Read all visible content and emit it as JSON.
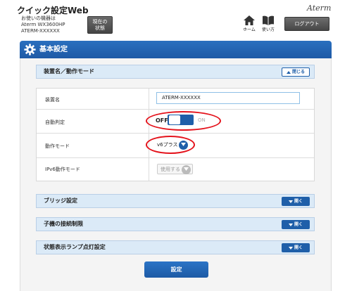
{
  "header": {
    "app_title": "クイック設定Web",
    "device_line1": "お使いの機器は",
    "device_line2": "Aterm WX3600HP",
    "device_line3": "ATERM-XXXXXX",
    "status_button_line1": "現在の",
    "status_button_line2": "状態",
    "logo": "Aterm",
    "home_label": "ホーム",
    "help_label": "使い方",
    "logout_label": "ログアウト"
  },
  "main": {
    "title": "基本設定"
  },
  "section_device": {
    "title": "装置名／動作モード",
    "toggle_label": "閉じる",
    "rows": {
      "device_name_label": "装置名",
      "device_name_value": "ATERM-XXXXXX",
      "auto_detect_label": "自動判定",
      "auto_detect_off": "OFF",
      "auto_detect_on": "ON",
      "mode_label": "動作モード",
      "mode_value": "v6プラス",
      "ipv6_label": "IPv6動作モード",
      "ipv6_value": "使用する"
    }
  },
  "sections_collapsed": [
    {
      "title": "ブリッジ設定",
      "toggle_label": "開く"
    },
    {
      "title": "子機の接続制限",
      "toggle_label": "開く"
    },
    {
      "title": "状態表示ランプ点灯設定",
      "toggle_label": "開く"
    }
  ],
  "submit_label": "設定",
  "colors": {
    "accent_blue": "#1f5fa9",
    "highlight_red": "#e4121b",
    "section_bg": "#dbeaf7"
  }
}
